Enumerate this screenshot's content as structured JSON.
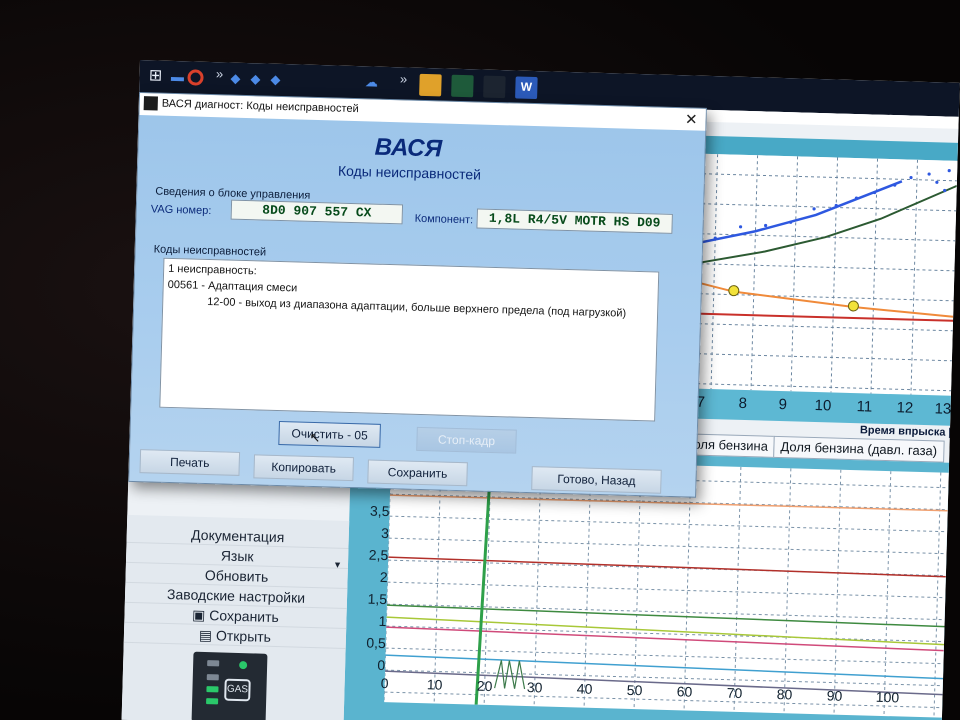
{
  "dialog": {
    "title": "ВАСЯ диагност: Коды неисправностей",
    "brand": "ВАСЯ",
    "subtitle": "Коды неисправностей",
    "ecu_group_label": "Сведения о блоке управления",
    "vag_label": "VAG номер:",
    "vag_value": "8D0 907 557 CX",
    "component_label": "Компонент:",
    "component_value": "1,8L R4/5V  MOTR HS D09",
    "faults_group_label": "Коды неисправностей",
    "faults": {
      "count_line": "1 неисправность:",
      "code_line": "00561 -   Адаптация смеси",
      "detail_line": "12-00 -   выход из диапазона адаптации, больше верхнего предела (под нагрузкой)"
    },
    "buttons": {
      "clear": "Очистить - 05",
      "freeze": "Стоп-кадр",
      "print": "Печать",
      "copy": "Копировать",
      "save": "Сохранить",
      "done": "Готово, Назад"
    },
    "close_glyph": "✕"
  },
  "background": {
    "chart_top_x_ticks": [
      "7",
      "8",
      "9",
      "10",
      "11",
      "12",
      "13"
    ],
    "chart_top_axis_title": "Время впрыска [",
    "tabs": [
      "Доля бензина",
      "Доля бензина (давл. газа)"
    ],
    "chart_bottom_y_ticks": [
      "3,5",
      "3",
      "2,5",
      "2",
      "1,5",
      "1",
      "0,5",
      "0"
    ],
    "chart_bottom_x_ticks": [
      "0",
      "10",
      "20",
      "30",
      "40",
      "50",
      "60",
      "70",
      "80",
      "90",
      "100"
    ],
    "left_menu": [
      "Документация",
      "Язык",
      "Обновить",
      "Заводские настройки",
      "Сохранить",
      "Открыть"
    ],
    "device_label": "GAS"
  },
  "taskbar": {
    "chevron": "»",
    "word_label": "W"
  },
  "colors": {
    "dialog_bg": "#a9cdee",
    "brand": "#0a2a7a",
    "field_text": "#064a1a",
    "chart_cyan": "#5ab4cf"
  }
}
